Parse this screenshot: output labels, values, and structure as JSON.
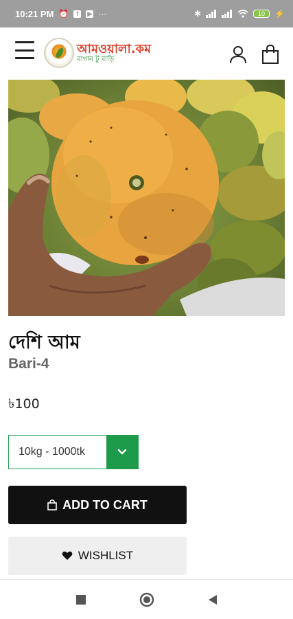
{
  "status_bar": {
    "time": "10:21 PM",
    "dots": "···",
    "battery": "10"
  },
  "header": {
    "logo_text": "আমওয়ালা.কম",
    "logo_tagline": "বাগান টু বাড়ি"
  },
  "product": {
    "title": "দেশি আম",
    "variant": "Bari-4",
    "price": "৳100",
    "selected_option": "10kg - 1000tk"
  },
  "actions": {
    "add_to_cart": "ADD TO CART",
    "wishlist": "WISHLIST"
  },
  "colors": {
    "accent_green": "#1d9a4a",
    "button_dark": "#111111",
    "status_bar": "#9e9e9e"
  }
}
